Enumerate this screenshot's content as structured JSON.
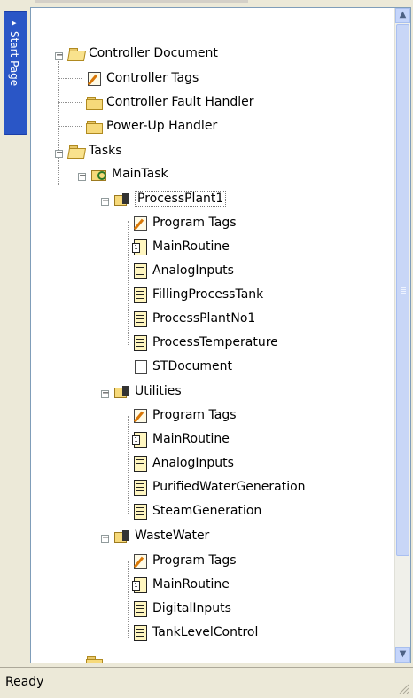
{
  "side_tab": {
    "label": "Start Page",
    "arrow": "▸"
  },
  "tree": {
    "controller_document": "Controller Document",
    "controller_tags": "Controller Tags",
    "controller_fault_handler": "Controller Fault Handler",
    "power_up_handler": "Power-Up Handler",
    "tasks": "Tasks",
    "main_task": "MainTask",
    "programs": [
      {
        "name": "ProcessPlant1",
        "items": [
          "Program Tags",
          "MainRoutine",
          "AnalogInputs",
          "FillingProcessTank",
          "ProcessPlantNo1",
          "ProcessTemperature",
          "STDocument"
        ]
      },
      {
        "name": "Utilities",
        "items": [
          "Program Tags",
          "MainRoutine",
          "AnalogInputs",
          "PurifiedWaterGeneration",
          "SteamGeneration"
        ]
      },
      {
        "name": "WasteWater",
        "items": [
          "Program Tags",
          "MainRoutine",
          "DigitalInputs",
          "TankLevelControl"
        ]
      }
    ]
  },
  "expander_symbol": "−",
  "scroll": {
    "up": "▲",
    "down": "▼"
  },
  "status_bar": {
    "text": "Ready"
  }
}
